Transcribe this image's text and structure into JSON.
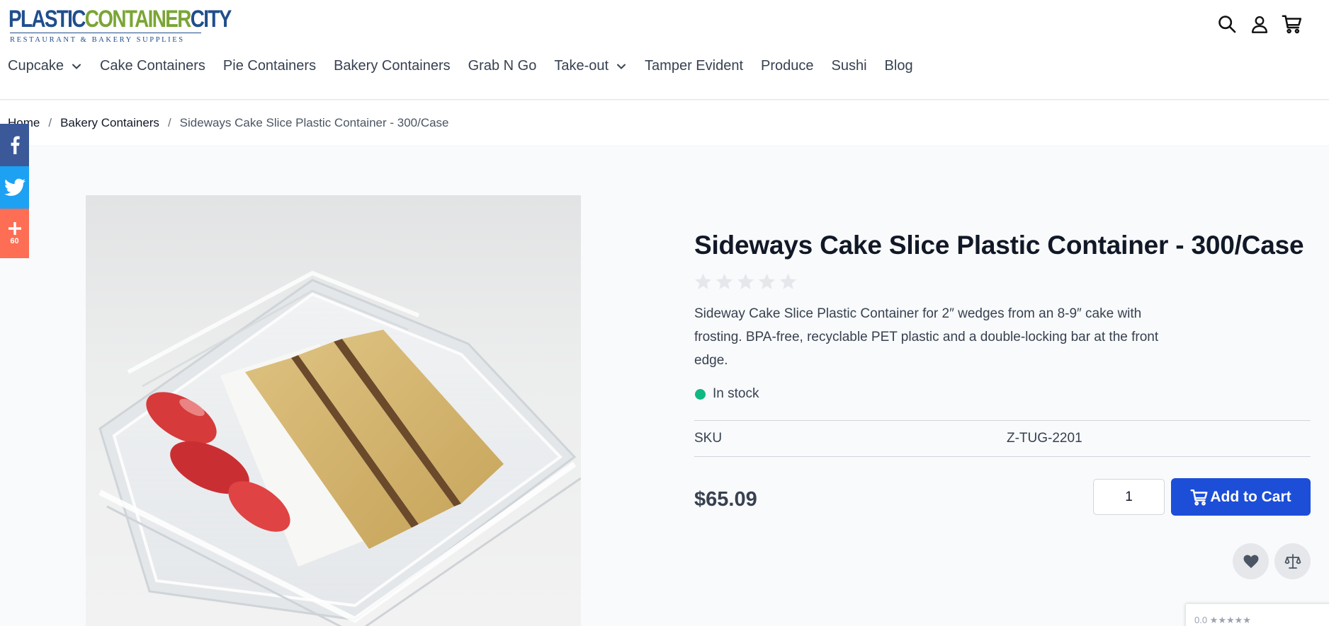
{
  "brand": {
    "logo_part1": "PLASTIC",
    "logo_part2": "CONTAINER",
    "logo_part3": "CITY",
    "tagline": "RESTAURANT & BAKERY SUPPLIES",
    "colors": {
      "primary": "#1f4e8c",
      "accent": "#7aa534"
    }
  },
  "header": {
    "icons": [
      "search-icon",
      "account-icon",
      "cart-icon"
    ]
  },
  "nav": {
    "items": [
      {
        "label": "Cupcake",
        "has_dropdown": true
      },
      {
        "label": "Cake Containers",
        "has_dropdown": false
      },
      {
        "label": "Pie Containers",
        "has_dropdown": false
      },
      {
        "label": "Bakery Containers",
        "has_dropdown": false
      },
      {
        "label": "Grab N Go",
        "has_dropdown": false
      },
      {
        "label": "Take-out",
        "has_dropdown": true
      },
      {
        "label": "Tamper Evident",
        "has_dropdown": false
      },
      {
        "label": "Produce",
        "has_dropdown": false
      },
      {
        "label": "Sushi",
        "has_dropdown": false
      },
      {
        "label": "Blog",
        "has_dropdown": false
      }
    ]
  },
  "breadcrumb": {
    "items": [
      "Home",
      "Bakery Containers"
    ],
    "current": "Sideways Cake Slice Plastic Container - 300/Case",
    "separator": "/"
  },
  "social": {
    "plus_count": "60",
    "colors": {
      "facebook": "#3b5998",
      "twitter": "#1da1f2",
      "share": "#fd6e55"
    }
  },
  "product": {
    "title": "Sideways Cake Slice Plastic Container - 300/Case",
    "rating": 0,
    "rating_max": 5,
    "description": "Sideway Cake Slice Plastic Container for 2″ wedges from an 8-9″ cake with frosting. BPA-free, recyclable PET plastic and a double-locking bar at the front edge.",
    "stock_status": "In stock",
    "stock_color": "#10b981",
    "sku_label": "SKU",
    "sku_value": "Z-TUG-2201",
    "price": "$65.09",
    "quantity": "1",
    "add_to_cart_label": "Add to Cart",
    "button_color": "#1d4ed8"
  },
  "review_badge": {
    "text": "0.0 ★★★★★"
  }
}
